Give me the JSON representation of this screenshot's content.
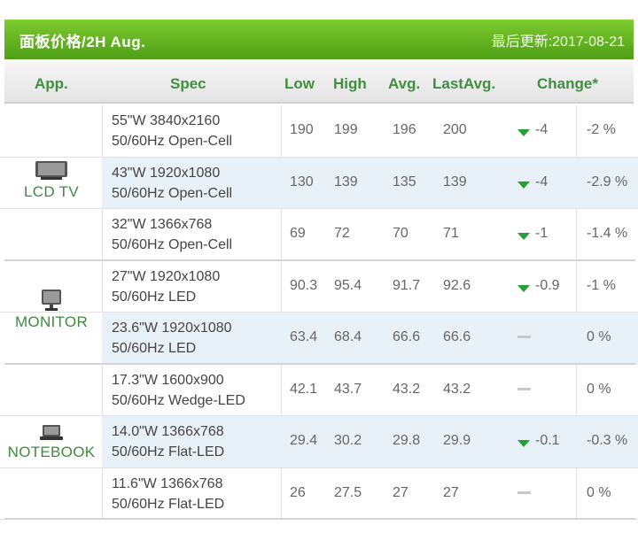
{
  "header": {
    "title": "面板价格/2H Aug.",
    "updated": "最后更新:2017-08-21"
  },
  "columns": {
    "app": "App.",
    "spec": "Spec",
    "low": "Low",
    "high": "High",
    "avg": "Avg.",
    "last_avg": "LastAvg.",
    "change": "Change*"
  },
  "groups": [
    {
      "label": "LCD TV",
      "icon": "tv-icon"
    },
    {
      "label": "MONITOR",
      "icon": "monitor-icon"
    },
    {
      "label": "NOTEBOOK",
      "icon": "laptop-icon"
    }
  ],
  "rows": [
    {
      "spec1": "55\"W 3840x2160",
      "spec2": "50/60Hz Open-Cell",
      "low": "190",
      "high": "199",
      "avg": "196",
      "last": "200",
      "dir": "down",
      "chg": "-4",
      "pct": "-2 %"
    },
    {
      "spec1": "43\"W 1920x1080",
      "spec2": "50/60Hz Open-Cell",
      "low": "130",
      "high": "139",
      "avg": "135",
      "last": "139",
      "dir": "down",
      "chg": "-4",
      "pct": "-2.9 %"
    },
    {
      "spec1": "32\"W 1366x768",
      "spec2": "50/60Hz Open-Cell",
      "low": "69",
      "high": "72",
      "avg": "70",
      "last": "71",
      "dir": "down",
      "chg": "-1",
      "pct": "-1.4 %"
    },
    {
      "spec1": "27\"W 1920x1080",
      "spec2": "50/60Hz LED",
      "low": "90.3",
      "high": "95.4",
      "avg": "91.7",
      "last": "92.6",
      "dir": "down",
      "chg": "-0.9",
      "pct": "-1 %"
    },
    {
      "spec1": "23.6\"W 1920x1080",
      "spec2": "50/60Hz LED",
      "low": "63.4",
      "high": "68.4",
      "avg": "66.6",
      "last": "66.6",
      "dir": "flat",
      "chg": "",
      "pct": "0 %"
    },
    {
      "spec1": "17.3\"W 1600x900",
      "spec2": "50/60Hz Wedge-LED",
      "low": "42.1",
      "high": "43.7",
      "avg": "43.2",
      "last": "43.2",
      "dir": "flat",
      "chg": "",
      "pct": "0 %"
    },
    {
      "spec1": "14.0\"W 1366x768",
      "spec2": "50/60Hz Flat-LED",
      "low": "29.4",
      "high": "30.2",
      "avg": "29.8",
      "last": "29.9",
      "dir": "down",
      "chg": "-0.1",
      "pct": "-0.3 %"
    },
    {
      "spec1": "11.6\"W 1366x768",
      "spec2": "50/60Hz Flat-LED",
      "low": "26",
      "high": "27.5",
      "avg": "27",
      "last": "27",
      "dir": "flat",
      "chg": "",
      "pct": "0 %"
    }
  ],
  "colors": {
    "header_green": "#5aad1c",
    "label_green": "#3d8c3d",
    "down_triangle": "#22a32f",
    "alt_row": "#e8f0f8"
  }
}
